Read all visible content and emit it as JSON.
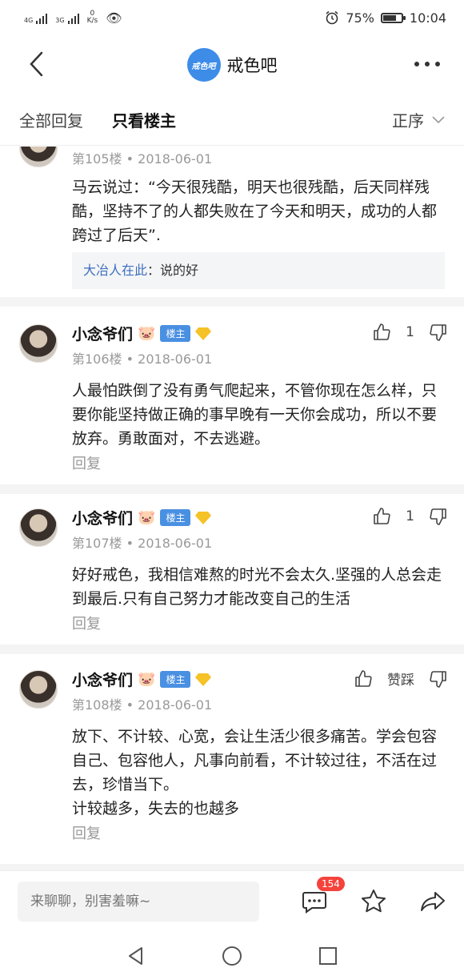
{
  "status_bar": {
    "sig1_label": "4G",
    "sig2_label": "3G",
    "net_speed_value": "0",
    "net_speed_unit": "K/s",
    "battery_percent": "75%",
    "battery_level": 0.75,
    "time": "10:04"
  },
  "header": {
    "forum_logo_text": "戒色吧",
    "forum_name": "戒色吧"
  },
  "tabs": {
    "all_replies": "全部回复",
    "owner_only": "只看楼主",
    "sort": "正序"
  },
  "posts": [
    {
      "floor_date": "第105楼 • 2018-06-01",
      "content": "马云说过：“今天很残酷，明天也很残酷，后天同样残酷，坚持不了的人都失败在了今天和明天，成功的人都跨过了后天”.",
      "quote_name": "大冶人在此",
      "quote_sep": "：",
      "quote_text": "说的好"
    },
    {
      "username": "小念爷们",
      "badge": "楼主",
      "floor_date": "第106楼 • 2018-06-01",
      "likes": "1",
      "content": "人最怕跌倒了没有勇气爬起来，不管你现在怎么样，只要你能坚持做正确的事早晚有一天你会成功，所以不要放弃。勇敢面对，不去逃避。",
      "reply": "回复"
    },
    {
      "username": "小念爷们",
      "badge": "楼主",
      "floor_date": "第107楼 • 2018-06-01",
      "likes": "1",
      "content": "好好戒色，我相信难熬的时光不会太久.坚强的人总会走到最后.只有自己努力才能改变自己的生活",
      "reply": "回复"
    },
    {
      "username": "小念爷们",
      "badge": "楼主",
      "floor_date": "第108楼 • 2018-06-01",
      "likes": "赞踩",
      "content1": "放下、不计较、心宽，会让生活少很多痛苦。学会包容自己、包容他人，凡事向前看，不计较过往，不活在过去，珍惜当下。",
      "content2": "计较越多，失去的也越多",
      "reply": "回复"
    }
  ],
  "bottom_bar": {
    "input_placeholder": "来聊聊，别害羞嘛~",
    "comment_count": "154"
  }
}
